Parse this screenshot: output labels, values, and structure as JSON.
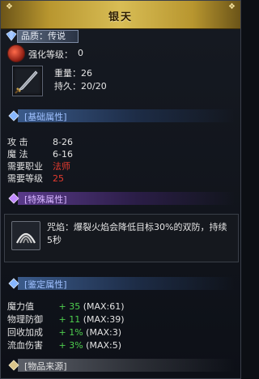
{
  "title": "银天",
  "quality": {
    "label": "品质：传说"
  },
  "enhance": {
    "label": "强化等级：",
    "value": "0"
  },
  "item": {
    "weight_label": "重量：",
    "weight_value": "26",
    "durability_label": "持久：",
    "durability_value": "20/20"
  },
  "sections": {
    "basic": "[基础属性]",
    "special": "[特殊属性]",
    "identify": "[鉴定属性]",
    "source": "[物品来源]"
  },
  "basic_attrs": [
    {
      "k": "攻    击",
      "v": "8-26",
      "color": "normal"
    },
    {
      "k": "魔    法",
      "v": "6-16",
      "color": "normal"
    },
    {
      "k": "需要职业",
      "v": "法师",
      "color": "red"
    },
    {
      "k": "需要等级",
      "v": "25",
      "color": "red"
    }
  ],
  "special": {
    "text": "咒焰：爆裂火焰会降低目标30%的双防，持续5秒"
  },
  "identify_attrs": [
    {
      "k": "魔力值",
      "plus": "+ 35",
      "max": "(MAX:61)"
    },
    {
      "k": "物理防御",
      "plus": "+ 11",
      "max": "(MAX:39)"
    },
    {
      "k": "回收加成",
      "plus": "+ 1%",
      "max": "(MAX:3)"
    },
    {
      "k": "流血伤害",
      "plus": "+ 3%",
      "max": "(MAX:5)"
    }
  ],
  "colors": {
    "header_gold": "#d8bd55",
    "section_blue": "#3a5a8a",
    "section_purple": "#5a3a8a",
    "bonus_green": "#4fd04f",
    "requirement_red": "#e63b2e"
  },
  "icons": {
    "quality": "blue-gem-icon",
    "enhance": "red-orb-icon",
    "item": "dagger-icon",
    "special": "claw-slash-icon"
  }
}
